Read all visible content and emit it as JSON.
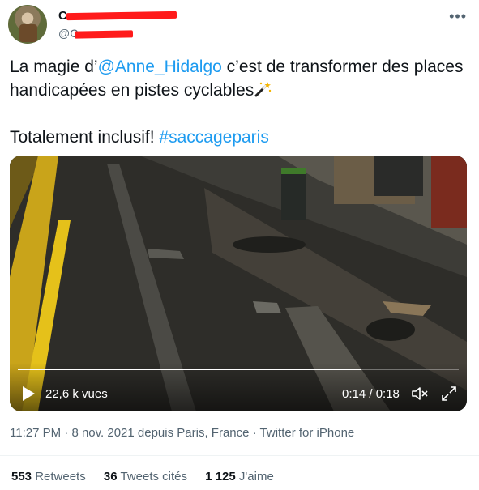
{
  "author": {
    "name": "C",
    "handle": "@C"
  },
  "menu_icon": "more-horizontal-icon",
  "tweet": {
    "prefix": "La magie d’",
    "mention": "@Anne_Hidalgo",
    "middle": " c’est de transformer des places handicapées en pistes cyclables",
    "emoji": "magic-wand-emoji",
    "line2_prefix": "Totalement inclusif! ",
    "hashtag": "#saccageparis"
  },
  "video": {
    "views": "22,6 k vues",
    "time": "0:14 / 0:18",
    "progress": 0.7778
  },
  "meta": {
    "time": "11:27 PM",
    "sep1": " · ",
    "date": "8 nov. 2021",
    "location_text": " depuis Paris, France",
    "sep2": " · ",
    "source": "Twitter for iPhone"
  },
  "stats": {
    "retweets_count": "553",
    "retweets_label": " Retweets",
    "quotes_count": "36",
    "quotes_label": " Tweets cités",
    "likes_count": "1 125",
    "likes_label": " J'aime"
  },
  "colors": {
    "link": "#1d9bf0",
    "redaction": "#ff1a1a"
  }
}
